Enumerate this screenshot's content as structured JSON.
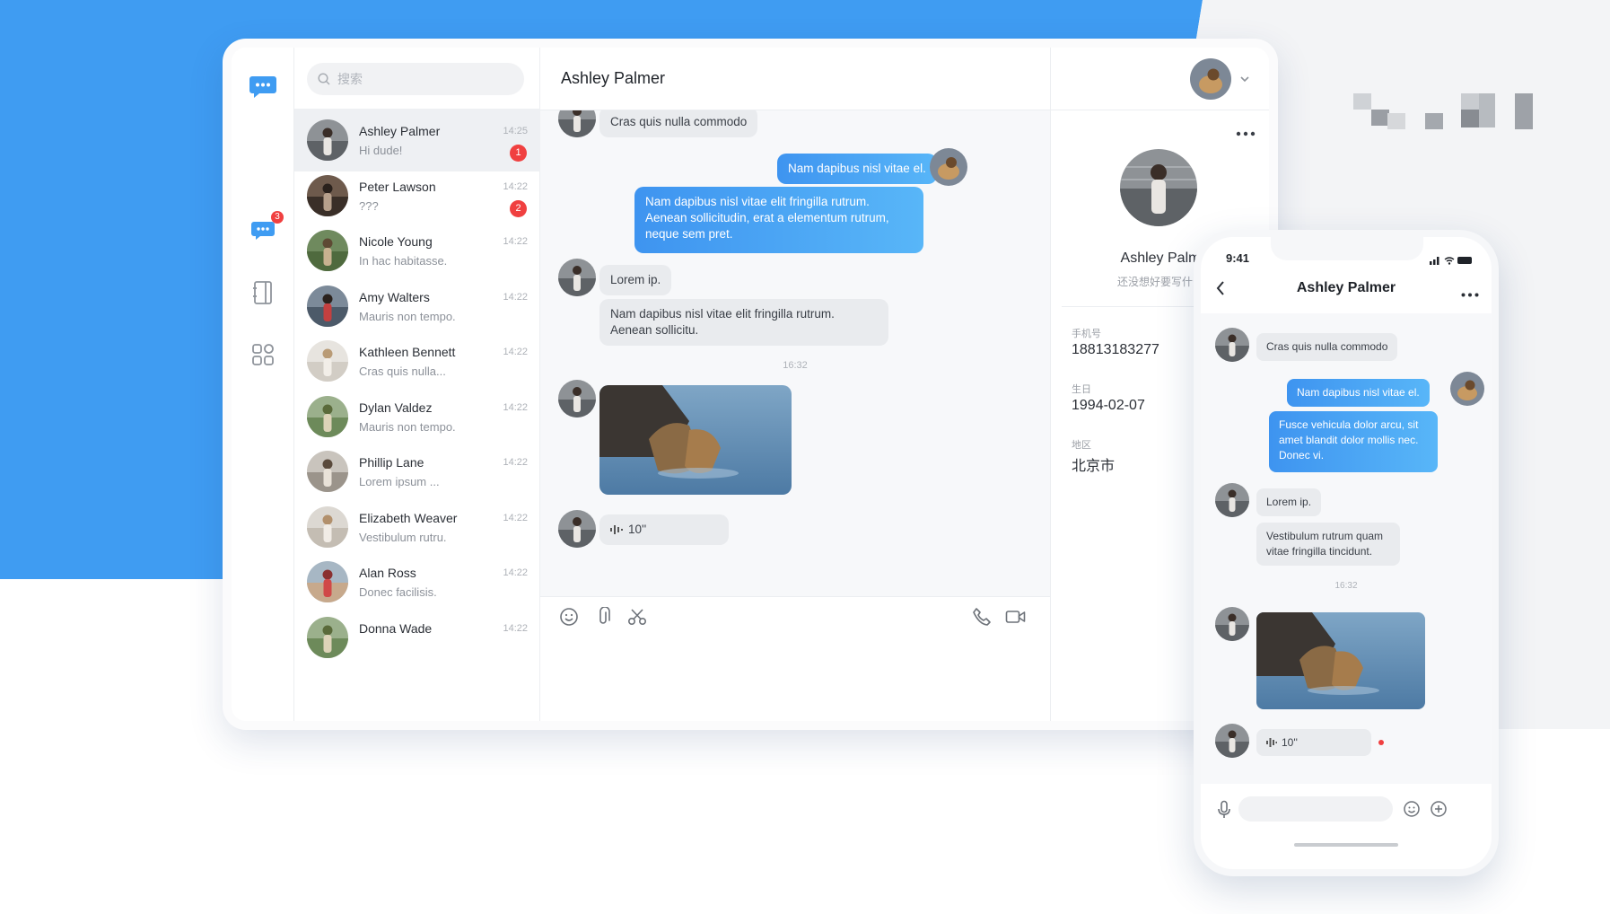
{
  "colors": {
    "brand": "#3f9cf2",
    "badge": "#f04040",
    "bubble_me": "#4aa3f5"
  },
  "rail": {
    "chat_badge": "3"
  },
  "search": {
    "placeholder": "搜索"
  },
  "conversations": [
    {
      "name": "Ashley Palmer",
      "preview": "Hi dude!",
      "time": "14:25",
      "unread": "1",
      "active": true
    },
    {
      "name": "Peter Lawson",
      "preview": "???",
      "time": "14:22",
      "unread": "2"
    },
    {
      "name": "Nicole Young",
      "preview": "In hac habitasse.",
      "time": "14:22",
      "unread": ""
    },
    {
      "name": "Amy Walters",
      "preview": "Mauris non tempo.",
      "time": "14:22",
      "unread": ""
    },
    {
      "name": "Kathleen Bennett",
      "preview": "Cras quis nulla...",
      "time": "14:22",
      "unread": ""
    },
    {
      "name": "Dylan Valdez",
      "preview": "Mauris non tempo.",
      "time": "14:22",
      "unread": ""
    },
    {
      "name": "Phillip Lane",
      "preview": "Lorem ipsum ...",
      "time": "14:22",
      "unread": ""
    },
    {
      "name": "Elizabeth Weaver",
      "preview": "Vestibulum rutru.",
      "time": "14:22",
      "unread": ""
    },
    {
      "name": "Alan Ross",
      "preview": "Donec facilisis.",
      "time": "14:22",
      "unread": ""
    },
    {
      "name": "Donna Wade",
      "preview": "",
      "time": "14:22",
      "unread": ""
    }
  ],
  "chat": {
    "title": "Ashley Palmer",
    "messages": [
      "Cras quis nulla commodo",
      "Nam dapibus nisl vitae el.",
      "Nam dapibus nisl vitae elit fringilla rutrum. Aenean sollicitudin, erat a elementum rutrum, neque sem pret.",
      "Lorem ip.",
      "Nam dapibus nisl vitae elit fringilla rutrum. Aenean sollicitu."
    ],
    "timestamp": "16:32",
    "voice": "10''"
  },
  "detail": {
    "name": "Ashley Palm",
    "bio": "还没想好要写什么",
    "phone_label": "手机号",
    "phone": "18813183277",
    "birthday_label": "生日",
    "birthday": "1994-02-07",
    "region_label": "地区",
    "region": "北京市"
  },
  "phone": {
    "time": "9:41",
    "title": "Ashley Palmer",
    "messages": [
      "Cras quis nulla commodo",
      "Nam dapibus nisl vitae el.",
      "Fusce vehicula dolor arcu, sit amet blandit dolor mollis nec. Donec vi.",
      "Lorem ip.",
      "Vestibulum rutrum quam vitae fringilla tincidunt."
    ],
    "timestamp": "16:32",
    "voice": "10''"
  },
  "icons": [
    "chat-logo-icon",
    "chat-icon",
    "contacts-icon",
    "apps-icon",
    "search-icon",
    "emoji-icon",
    "attach-icon",
    "scissors-icon",
    "phone-call-icon",
    "video-icon",
    "more-icon",
    "back-icon",
    "mic-icon",
    "plus-icon",
    "voice-wave-icon",
    "chevron-down-icon"
  ]
}
